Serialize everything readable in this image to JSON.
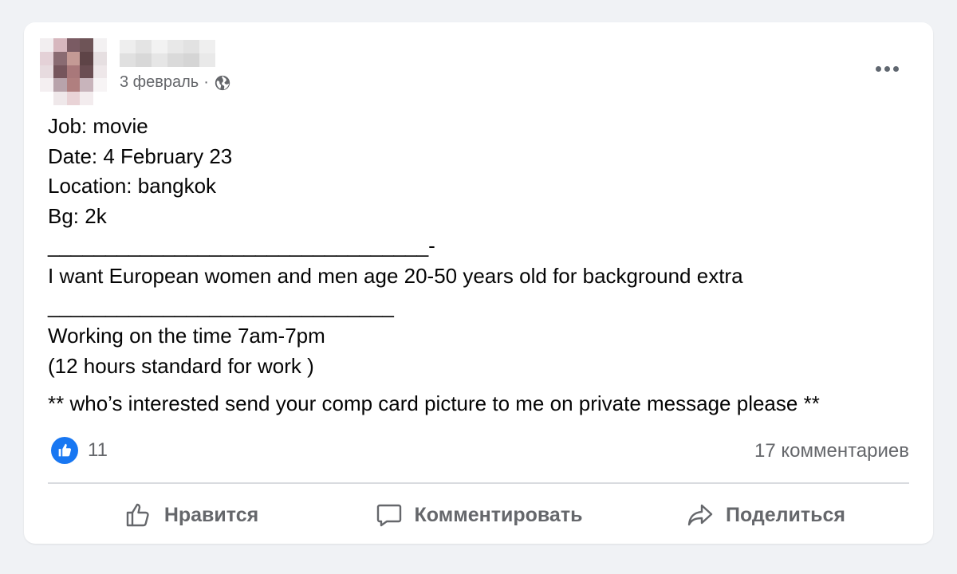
{
  "post": {
    "date": "3 февраль",
    "separator": "·",
    "privacy_icon": "globe-icon",
    "menu_icon": "more-options-icon",
    "lines": [
      "Job: movie",
      "Date: 4 February 23",
      "Location: bangkok",
      "Bg: 2k",
      "_________________________________-",
      "I want European women and men age 20-50 years old for background extra",
      "______________________________",
      "Working on the time 7am-7pm",
      "(12 hours standard for work )"
    ],
    "closing_line": "** who’s interested send your comp card picture to me on private message please **"
  },
  "stats": {
    "reaction_icon": "like-reaction-icon",
    "like_count": "11",
    "comments": "17 комментариев"
  },
  "actions": {
    "like_label": "Нравится",
    "comment_label": "Комментировать",
    "share_label": "Поделиться"
  },
  "colors": {
    "accent": "#1877f2",
    "secondary_text": "#65676b",
    "background": "#f0f2f5"
  }
}
